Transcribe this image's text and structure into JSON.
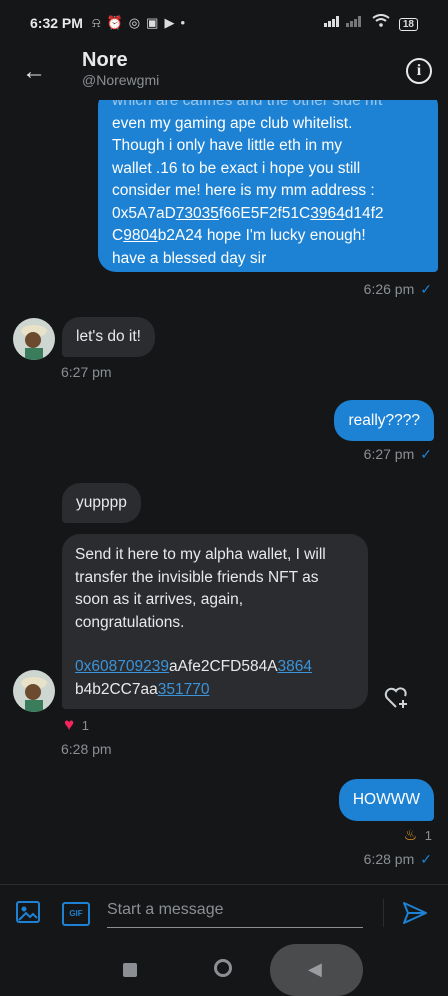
{
  "status_bar": {
    "time": "6:32 PM",
    "battery": "18"
  },
  "header": {
    "name": "Nore",
    "handle": "@Norewgmi"
  },
  "messages": {
    "m1": {
      "line0": "which are caffnes and the other side nft",
      "line1": "even my gaming ape club whitelist.",
      "line2": "Though i only have little eth in my",
      "line3": "wallet .16 to be exact i hope you still",
      "line4": "consider me! here is my mm address :",
      "line5_a": "0x5A7aD",
      "line5_b": "73035",
      "line5_c": "f66E5F2f51C",
      "line5_d": "3964",
      "line5_e": "d14f2",
      "line6_a": "C",
      "line6_b": "9804",
      "line6_c": "b2A24 hope I'm lucky enough!",
      "line7": "have a blessed day sir",
      "time": "6:26 pm"
    },
    "m2": {
      "text": "let's do it!",
      "time": "6:27 pm"
    },
    "m3": {
      "text": "really????",
      "time": "6:27 pm"
    },
    "m4": {
      "text": "yupppp"
    },
    "m5": {
      "line1": "Send it here to my alpha wallet, I will",
      "line2": "transfer the invisible friends NFT as",
      "line3": "soon as it arrives, again,",
      "line4": "congratulations.",
      "addr_a": "0x608709239",
      "addr_b": "aAfe2CFD584A",
      "addr_c": "3864",
      "addr_d": "b4b2CC7aa",
      "addr_e": "351770",
      "reaction_count": "1",
      "time": "6:28 pm"
    },
    "m6": {
      "text": "HOWWW",
      "reaction_count": "1",
      "time": "6:28 pm"
    }
  },
  "composer": {
    "placeholder": "Start a message",
    "gif_label": "GIF"
  },
  "colors": {
    "accent": "#1d82d3",
    "background": "#151617",
    "incoming_bubble": "#2a2c2f"
  }
}
